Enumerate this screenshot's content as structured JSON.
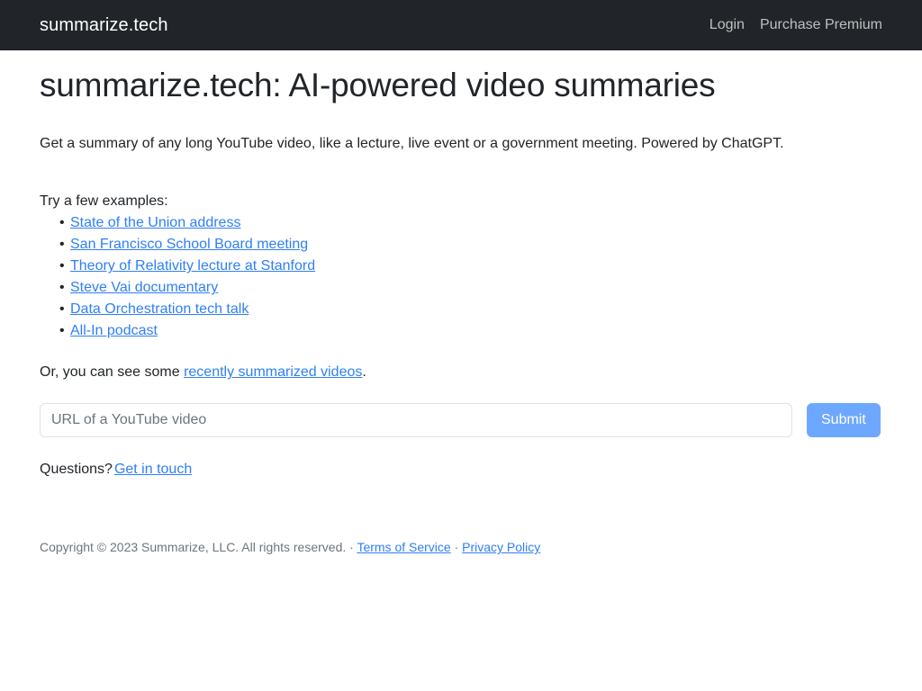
{
  "navbar": {
    "brand": "summarize.tech",
    "links": [
      {
        "label": "Login"
      },
      {
        "label": "Purchase Premium"
      }
    ]
  },
  "main": {
    "title": "summarize.tech: AI-powered video summaries",
    "lede": "Get a summary of any long YouTube video, like a lecture, live event or a government meeting. Powered by ChatGPT.",
    "examples_label": "Try a few examples:",
    "examples": [
      {
        "label": "State of the Union address"
      },
      {
        "label": "San Francisco School Board meeting"
      },
      {
        "label": "Theory of Relativity lecture at Stanford"
      },
      {
        "label": "Steve Vai documentary"
      },
      {
        "label": "Data Orchestration tech talk"
      },
      {
        "label": "All-In podcast"
      }
    ],
    "recent": {
      "prefix": "Or, you can see some ",
      "link_label": "recently summarized videos",
      "suffix": "."
    },
    "form": {
      "input_value": "",
      "input_placeholder": "URL of a YouTube video",
      "submit_label": "Submit"
    },
    "questions": {
      "prefix": "Questions?",
      "link_label": "Get in touch"
    }
  },
  "footer": {
    "copyright": "Copyright © 2023 Summarize, LLC. All rights reserved. ·",
    "terms_label": "Terms of Service",
    "separator": "·",
    "privacy_label": "Privacy Policy"
  },
  "colors": {
    "navbar_bg": "#212529",
    "link_blue": "#2f7ff5",
    "submit_bg": "#6ea8fe",
    "body_text": "#212529",
    "muted_text": "#6c757d",
    "input_border": "#dee2e6"
  }
}
